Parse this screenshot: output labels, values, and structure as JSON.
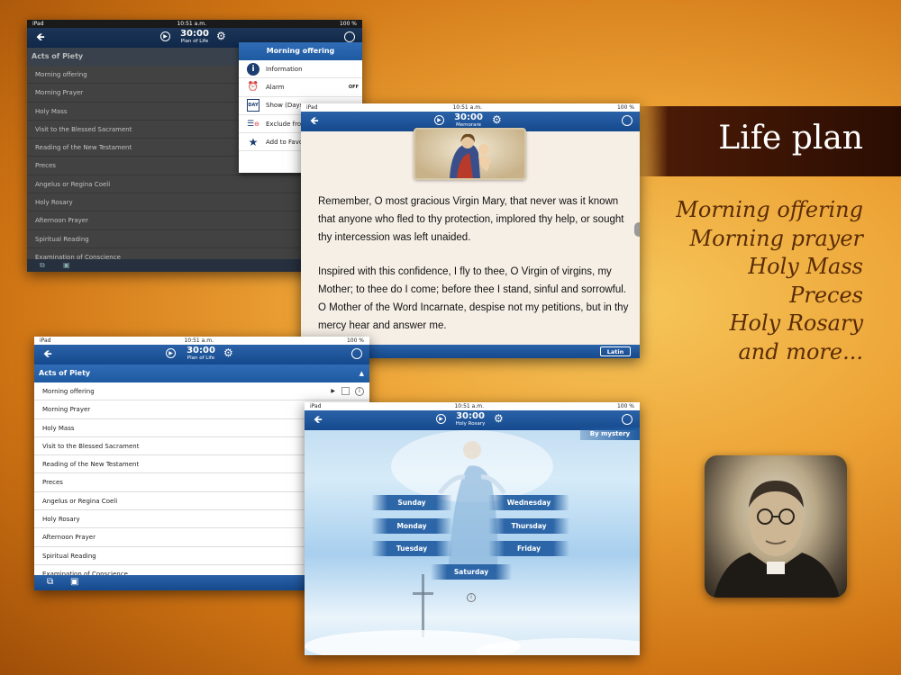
{
  "title_banner": "Life plan",
  "promo_lines": [
    "Morning offering",
    "Morning prayer",
    "Holy Mass",
    "Preces",
    "Holy Rosary",
    "and more..."
  ],
  "status": {
    "device": "iPad",
    "time": "10:51 a.m.",
    "battery": "100 %"
  },
  "nav": {
    "time": "30:00",
    "plan_label": "Plan of Life",
    "memorare_label": "Memorare",
    "rosary_label": "Holy Rosary"
  },
  "acts": {
    "header": "Acts of Piety",
    "items": [
      "Morning offering",
      "Morning Prayer",
      "Holy Mass",
      "Visit to the Blessed Sacrament",
      "Reading of the New Testament",
      "Preces",
      "Angelus or Regina Coeli",
      "Holy Rosary",
      "Afternoon Prayer",
      "Spiritual Reading",
      "Examination of Conscience"
    ]
  },
  "menu": {
    "title": "Morning offering",
    "items": [
      "Information",
      "Alarm",
      "Show (Days",
      "Exclude from",
      "Add to Favo"
    ],
    "alarm_state": "OFF"
  },
  "prayer": {
    "para1": "Remember, O most gracious Virgin Mary, that never was it known that anyone who fled to thy protection, implored thy help, or sought thy intercession was left unaided.",
    "para2": "Inspired with this confidence, I fly to thee, O Virgin of virgins, my Mother; to thee do I come; before thee I stand, sinful and sorrowful. O Mother of the Word Incarnate, despise not my petitions, but in thy mercy hear and answer me.",
    "latin_button": "Latin"
  },
  "rosary": {
    "by_mystery": "By mystery",
    "days": [
      "Sunday",
      "Monday",
      "Tuesday",
      "Wednesday",
      "Thursday",
      "Friday",
      "Saturday"
    ]
  }
}
